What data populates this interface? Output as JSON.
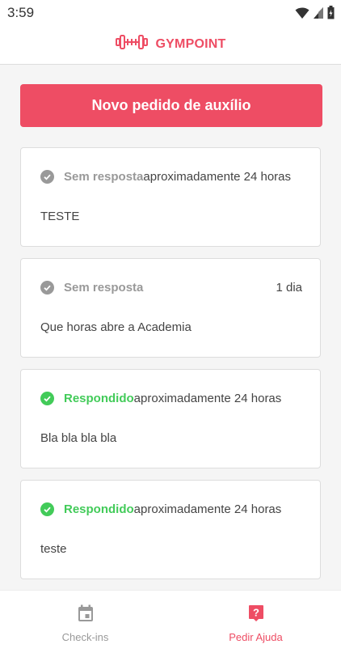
{
  "status_bar": {
    "time": "3:59",
    "icons": [
      "wifi-icon",
      "signal-icon",
      "battery-icon"
    ]
  },
  "header": {
    "brand": "GYMPOINT",
    "logo_icon": "dumbbell-icon"
  },
  "colors": {
    "accent": "#ee4d64",
    "answered": "#42cb59",
    "unanswered": "#999999",
    "nav_inactive": "#999999"
  },
  "main": {
    "new_request_label": "Novo pedido de auxílio",
    "requests": [
      {
        "status": "Sem resposta",
        "answered": false,
        "time": "aproximadamente 24 horas",
        "time_align": "inline",
        "question": "TESTE"
      },
      {
        "status": "Sem resposta",
        "answered": false,
        "time": "1 dia",
        "time_align": "right",
        "question": "Que horas abre a Academia"
      },
      {
        "status": "Respondido",
        "answered": true,
        "time": "aproximadamente 24 horas",
        "time_align": "inline",
        "question": "Bla bla bla bla"
      },
      {
        "status": "Respondido",
        "answered": true,
        "time": "aproximadamente 24 horas",
        "time_align": "inline",
        "question": "teste"
      }
    ]
  },
  "bottom_nav": {
    "items": [
      {
        "label": "Check-ins",
        "icon": "calendar-icon",
        "active": false
      },
      {
        "label": "Pedir Ajuda",
        "icon": "help-icon",
        "active": true
      }
    ]
  }
}
